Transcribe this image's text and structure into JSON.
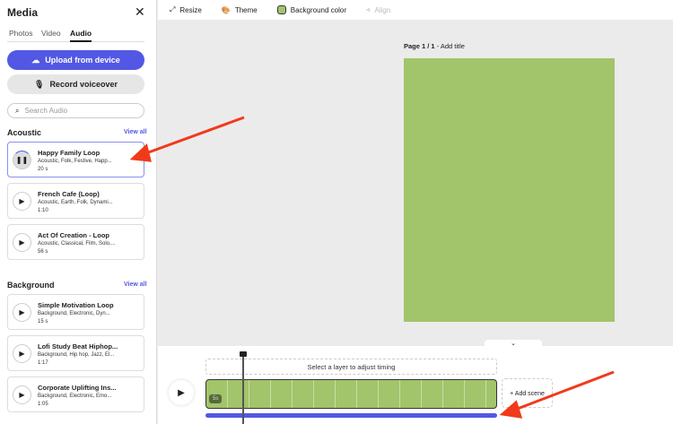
{
  "sidebar": {
    "title": "Media",
    "tabs": [
      "Photos",
      "Video",
      "Audio"
    ],
    "upload": "Upload from device",
    "record": "Record voiceover",
    "search_placeholder": "Search Audio",
    "sections": [
      {
        "title": "Acoustic",
        "view_all": "View all",
        "items": [
          {
            "title": "Happy Family Loop",
            "tags": "Acoustic, Folk, Festive, Happ...",
            "duration": "20 s"
          },
          {
            "title": "French Cafe (Loop)",
            "tags": "Acoustic, Earth, Folk, Dynami...",
            "duration": "1:10"
          },
          {
            "title": "Act Of Creation - Loop",
            "tags": "Acoustic, Classical, Film, Solo,...",
            "duration": "56 s"
          }
        ]
      },
      {
        "title": "Background",
        "view_all": "View all",
        "items": [
          {
            "title": "Simple Motivation Loop",
            "tags": "Background, Electronic, Dyn...",
            "duration": "15 s"
          },
          {
            "title": "Lofi Study Beat Hiphop...",
            "tags": "Background, Hip hop, Jazz, El...",
            "duration": "1:17"
          },
          {
            "title": "Corporate Uplifting Ins...",
            "tags": "Background, Electronic, Emo...",
            "duration": "1:05"
          }
        ]
      }
    ]
  },
  "toolbar": {
    "resize": "Resize",
    "theme": "Theme",
    "bg": "Background color",
    "align": "Align"
  },
  "canvas": {
    "page_num": "Page 1 / 1",
    "sep": " - ",
    "add_title": "Add title",
    "bg_color": "#a2c46a"
  },
  "timeline": {
    "hint": "Select a layer to adjust timing",
    "duration": "5s",
    "add_scene": "+ Add scene"
  }
}
